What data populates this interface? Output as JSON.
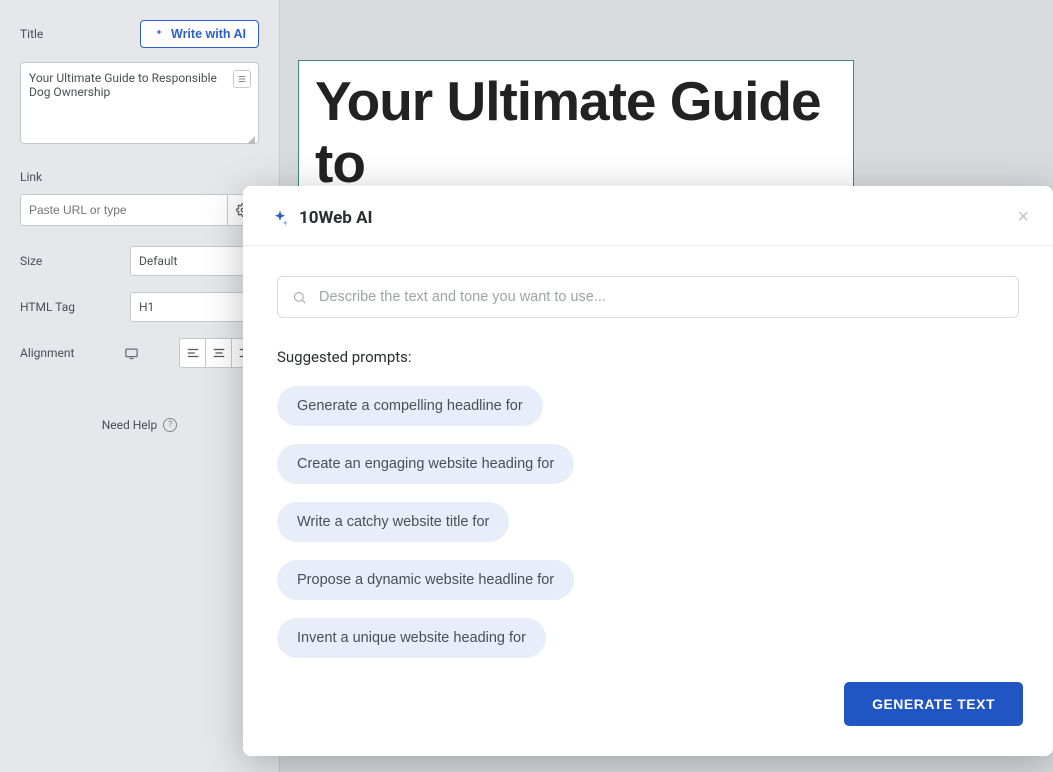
{
  "sidebar": {
    "title_label": "Title",
    "write_ai_label": "Write with AI",
    "title_value": "Your Ultimate Guide to Responsible Dog Ownership",
    "link_label": "Link",
    "link_placeholder": "Paste URL or type",
    "size_label": "Size",
    "size_value": "Default",
    "htmltag_label": "HTML Tag",
    "htmltag_value": "H1",
    "alignment_label": "Alignment",
    "need_help": "Need Help"
  },
  "canvas": {
    "heading_visible": "Your Ultimate Guide to"
  },
  "modal": {
    "brand": "10Web AI",
    "input_placeholder": "Describe the text and tone you want to use...",
    "suggested_label": "Suggested prompts:",
    "prompts": [
      "Generate a compelling headline for",
      "Create an engaging website heading for",
      "Write a catchy website title for",
      "Propose a dynamic website headline for",
      "Invent a unique website heading for"
    ],
    "generate_label": "GENERATE TEXT"
  }
}
